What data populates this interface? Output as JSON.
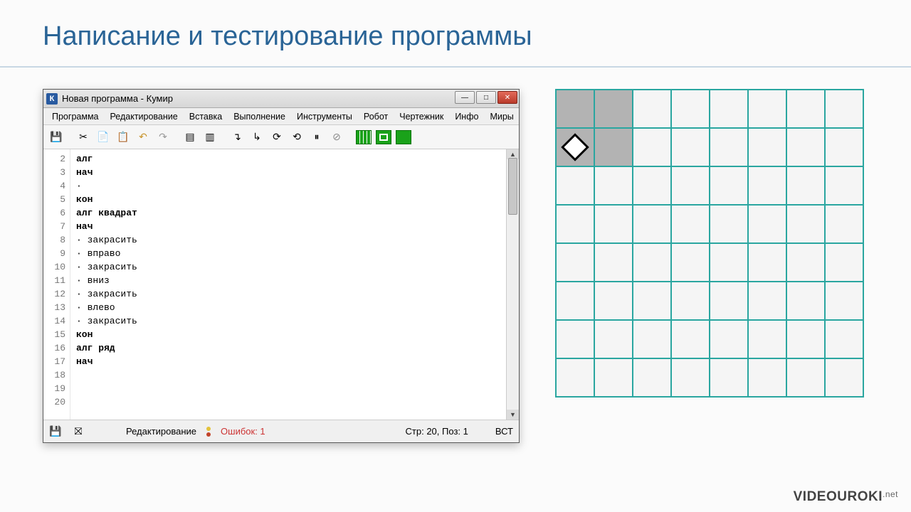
{
  "slide": {
    "title": "Написание и тестирование программы"
  },
  "window": {
    "appicon": "К",
    "title": "Новая программа - Кумир",
    "wincontrols": {
      "min": "—",
      "max": "□",
      "close": "✕"
    },
    "menu": [
      "Программа",
      "Редактирование",
      "Вставка",
      "Выполнение",
      "Инструменты",
      "Робот",
      "Чертежник",
      "Инфо",
      "Миры"
    ]
  },
  "code": {
    "lines": [
      {
        "n": 2,
        "t": "алг",
        "kw": true
      },
      {
        "n": 3,
        "t": "нач",
        "kw": true
      },
      {
        "n": 4,
        "t": "·"
      },
      {
        "n": 5,
        "t": "кон",
        "kw": true
      },
      {
        "n": 6,
        "t": ""
      },
      {
        "n": 7,
        "t": "алг квадрат",
        "kw": true
      },
      {
        "n": 8,
        "t": "нач",
        "kw": true
      },
      {
        "n": 9,
        "t": "· закрасить"
      },
      {
        "n": 10,
        "t": "· вправо"
      },
      {
        "n": 11,
        "t": "· закрасить"
      },
      {
        "n": 12,
        "t": "· вниз"
      },
      {
        "n": 13,
        "t": "· закрасить"
      },
      {
        "n": 14,
        "t": "· влево"
      },
      {
        "n": 15,
        "t": "· закрасить"
      },
      {
        "n": 16,
        "t": "кон",
        "kw": true
      },
      {
        "n": 17,
        "t": ""
      },
      {
        "n": 18,
        "t": "алг ряд",
        "kw": true
      },
      {
        "n": 19,
        "t": "нач",
        "kw": true
      },
      {
        "n": 20,
        "t": ""
      }
    ]
  },
  "status": {
    "mode": "Редактирование",
    "errors": "Ошибок: 1",
    "pos": "Стр: 20, Поз: 1",
    "ins": "ВСТ"
  },
  "robot": {
    "cols": 8,
    "rows": 8,
    "filled": [
      [
        0,
        0
      ],
      [
        0,
        1
      ],
      [
        1,
        0
      ],
      [
        1,
        1
      ]
    ],
    "robot_at": [
      1,
      0
    ]
  },
  "watermark": {
    "brand": "VIDEOUROKI",
    "suffix": ".net"
  }
}
